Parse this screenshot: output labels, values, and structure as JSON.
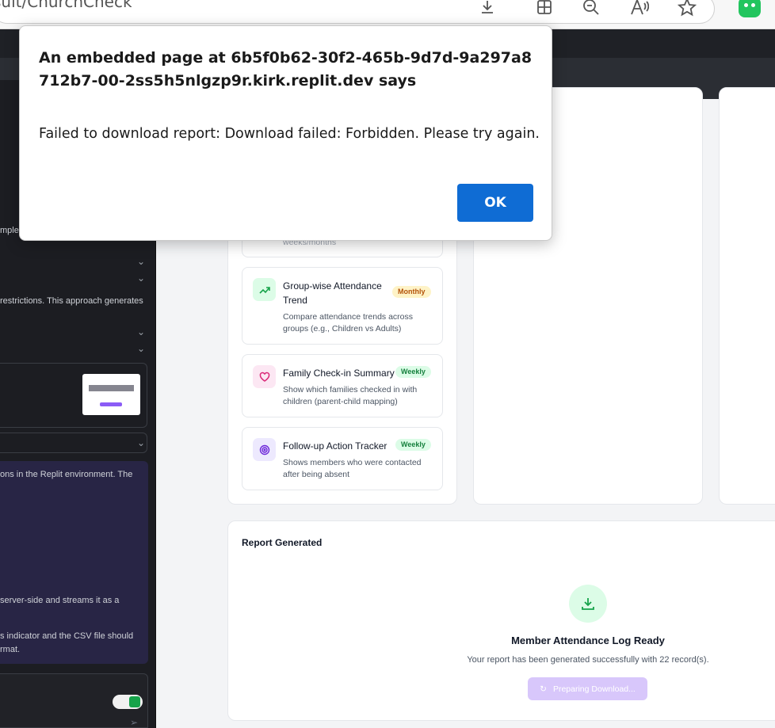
{
  "browser": {
    "address_text": "sult/ChurchCheck",
    "icons": [
      "download-icon",
      "extensions-icon",
      "zoom-out-icon",
      "read-aloud-icon",
      "favorite-icon",
      "copilot-icon"
    ]
  },
  "left_panel": {
    "lines": [
      {
        "text": "mpler"
      },
      {
        "text": "restrictions. This approach generates"
      },
      {
        "text": "ons in the Replit environment. The"
      },
      {
        "text": "server-side and streams it as a"
      },
      {
        "text": "s indicator and the CSV file should"
      },
      {
        "text": "rmat."
      }
    ]
  },
  "reports": [
    {
      "name": "",
      "desc": "weeks/months",
      "badge": "",
      "badge_type": "",
      "icon": ""
    },
    {
      "name": "Group-wise Attendance Trend",
      "desc": "Compare attendance trends across groups (e.g., Children vs Adults)",
      "badge": "Monthly",
      "badge_type": "monthly",
      "icon": "trend-up-icon"
    },
    {
      "name": "Family Check-in Summary",
      "desc": "Show which families checked in with children (parent-child mapping)",
      "badge": "Weekly",
      "badge_type": "weekly",
      "icon": "heart-icon"
    },
    {
      "name": "Follow-up Action Tracker",
      "desc": "Shows members who were contacted after being absent",
      "badge": "Weekly",
      "badge_type": "weekly",
      "icon": "target-icon"
    }
  ],
  "generated": {
    "section_title": "Report Generated",
    "heading": "Member Attendance Log Ready",
    "subtext": "Your report has been generated successfully with 22 record(s).",
    "button_label": "Preparing Download..."
  },
  "dialog": {
    "title": "An embedded page at 6b5f0b62-30f2-465b-9d7d-9a297a8712b7-00-2ss5h5nlgzp9r.kirk.replit.dev says",
    "message": "Failed to download report: Download failed: Forbidden. Please try again.",
    "ok_label": "OK"
  },
  "colors": {
    "ok_button": "#0f6cd4",
    "monthly_badge": "#fef3c7",
    "weekly_badge": "#dcfce7",
    "preparing_button": "#d8c7fb",
    "left_panel_bg": "#1c1d22"
  }
}
